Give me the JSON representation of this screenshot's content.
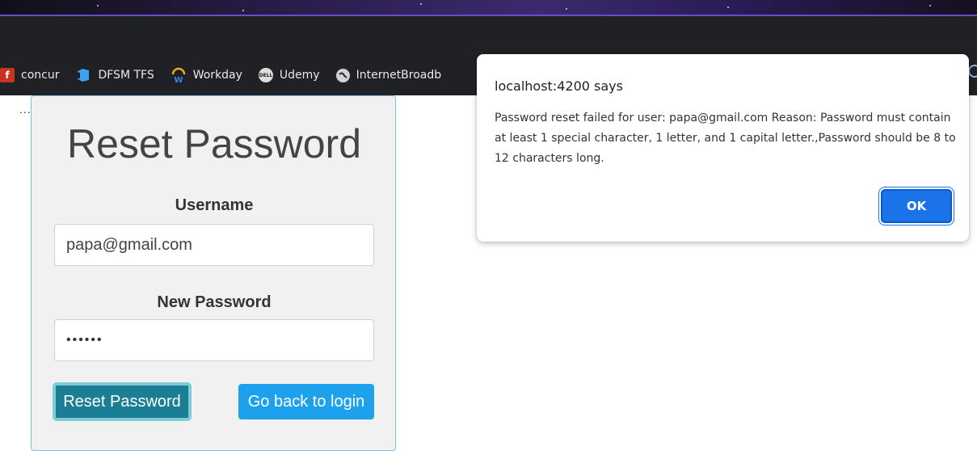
{
  "browser": {
    "bookmarks": [
      {
        "label": "concur",
        "icon": "concur-icon"
      },
      {
        "label": "DFSM TFS",
        "icon": "azure-devops-icon"
      },
      {
        "label": "Workday",
        "icon": "workday-icon"
      },
      {
        "label": "Udemy",
        "icon": "dell-icon"
      },
      {
        "label": "InternetBroadb",
        "icon": "globe-icon"
      }
    ],
    "overflow_label": "..."
  },
  "form": {
    "title": "Reset Password",
    "username_label": "Username",
    "username_value": "papa@gmail.com",
    "password_label": "New Password",
    "password_value": "••••••",
    "reset_button": "Reset Password",
    "back_button": "Go back to login"
  },
  "dialog": {
    "title": "localhost:4200 says",
    "message": "Password reset failed for user: papa@gmail.com Reason: Password must contain at least 1 special character, 1 letter, and 1 capital letter.,Password should be 8 to 12 characters long.",
    "ok_label": "OK"
  },
  "colors": {
    "reset_button": "#1a7f94",
    "back_button": "#1ea1ec",
    "dialog_ok": "#1a73e8",
    "browser_chrome": "#202124"
  }
}
